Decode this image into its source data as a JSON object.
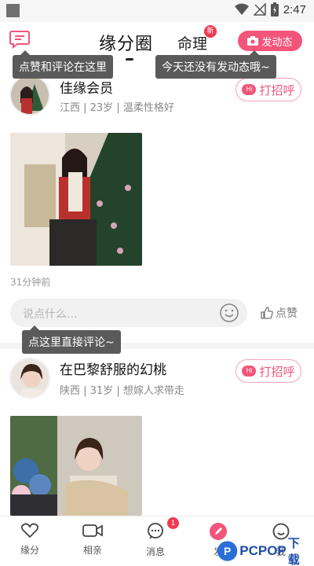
{
  "status_bar": {
    "time": "2:47"
  },
  "top_bar": {
    "main_tab": "缘分圈",
    "second_tab": "命理",
    "second_tab_badge": "新",
    "post_button": "发动态"
  },
  "tooltips": {
    "like_comment_here": "点赞和评论在这里",
    "no_posts_yet": "今天还没有发动态哦~",
    "comment_directly": "点这里直接评论~"
  },
  "posts": [
    {
      "name": "佳缘会员",
      "meta": "江西 | 23岁 | 温柔性格好",
      "greet": "打招呼",
      "greet_icon_text": "Hi",
      "time": "31分钟前",
      "comment_placeholder": "说点什么...",
      "like_label": "点赞"
    },
    {
      "name": "在巴黎舒服的幻桃",
      "meta": "陕西 | 31岁 | 想嫁人求带走",
      "greet": "打招呼",
      "greet_icon_text": "Hi"
    }
  ],
  "bottom_nav": {
    "items": [
      {
        "label": "缘分",
        "icon": "heart-icon"
      },
      {
        "label": "相亲",
        "icon": "video-icon"
      },
      {
        "label": "消息",
        "icon": "message-icon"
      },
      {
        "label": "发",
        "icon": "pen-icon"
      },
      {
        "label": "我",
        "icon": "smile-icon"
      }
    ],
    "message_badge": "1"
  },
  "watermark": {
    "brand": "PCPOP",
    "suffix": "下载"
  },
  "colors": {
    "accent": "#f3557a",
    "badge": "#f03a4f",
    "tooltip_bg": "#5a5a5a"
  }
}
